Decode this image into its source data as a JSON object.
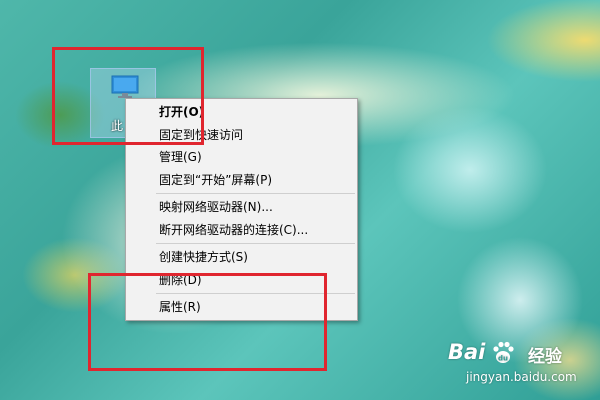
{
  "desktop": {
    "icon_label": "此"
  },
  "context_menu": {
    "items": [
      {
        "label": "打开(O)",
        "bold": true
      },
      {
        "label": "固定到快速访问"
      },
      {
        "label": "管理(G)"
      },
      {
        "label": "固定到“开始”屏幕(P)"
      },
      {
        "separator": true
      },
      {
        "label": "映射网络驱动器(N)..."
      },
      {
        "label": "断开网络驱动器的连接(C)..."
      },
      {
        "separator": true
      },
      {
        "label": "创建快捷方式(S)"
      },
      {
        "label": "删除(D)"
      },
      {
        "separator": true
      },
      {
        "label": "属性(R)"
      }
    ]
  },
  "annotations": {
    "color": "#e0262f"
  },
  "watermark": {
    "brand_left": "Bai",
    "brand_right": "经验",
    "site": "jingyan.baidu.com"
  }
}
